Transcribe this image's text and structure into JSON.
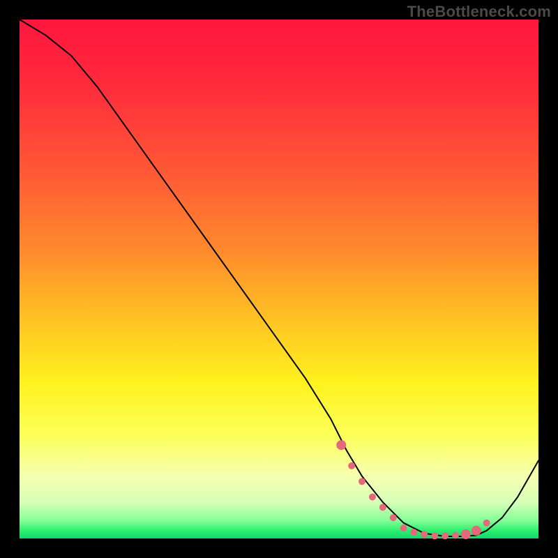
{
  "watermark": "TheBottleneck.com",
  "chart_data": {
    "type": "line",
    "title": "",
    "xlabel": "",
    "ylabel": "",
    "xlim": [
      0,
      100
    ],
    "ylim": [
      0,
      100
    ],
    "grid": false,
    "legend": false,
    "series": [
      {
        "name": "curve",
        "color": "#000000",
        "x": [
          0,
          5,
          10,
          15,
          20,
          25,
          30,
          35,
          40,
          45,
          50,
          55,
          60,
          63,
          66,
          70,
          74,
          78,
          82,
          85,
          88,
          90,
          93,
          96,
          100
        ],
        "y": [
          100,
          97,
          93,
          87,
          80,
          73,
          66,
          59,
          52,
          45,
          38,
          31,
          23,
          17,
          12,
          7,
          3,
          1,
          0.4,
          0.4,
          0.6,
          1.5,
          4,
          8,
          15
        ]
      }
    ],
    "markers": {
      "name": "highlight-dots",
      "color": "#e4697b",
      "radius_small": 5,
      "radius_large": 7,
      "x": [
        62,
        64,
        66,
        68,
        70,
        72,
        74,
        76,
        78,
        80,
        82,
        84,
        86,
        88,
        90
      ],
      "y": [
        18,
        14,
        11,
        8,
        6,
        4,
        2,
        1.2,
        0.8,
        0.5,
        0.5,
        0.6,
        0.8,
        1.5,
        3
      ],
      "large_indices": [
        0,
        12,
        13
      ]
    }
  }
}
